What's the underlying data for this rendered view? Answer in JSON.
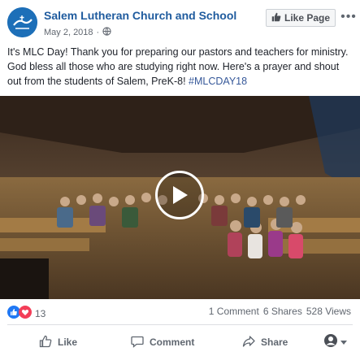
{
  "page": {
    "name": "Salem Lutheran Church and School",
    "date": "May 2, 2018",
    "like_page_label": "Like Page"
  },
  "post": {
    "text": "It's MLC Day! Thank you for preparing our pastors and teachers for ministry. God bless all those who are studying right now. Here's a prayer and shout out from the students of Salem, PreK-8!",
    "hashtag": "#MLCDAY18"
  },
  "video": {
    "description_icon": "play-icon"
  },
  "engagement": {
    "reaction_count": "13",
    "comments": "1 Comment",
    "shares": "6 Shares",
    "views": "528 Views"
  },
  "actions": {
    "like": "Like",
    "comment": "Comment",
    "share": "Share"
  },
  "colors": {
    "brand_blue": "#1f5b9e",
    "like_blue": "#2078f4",
    "love_red": "#f33e58"
  }
}
